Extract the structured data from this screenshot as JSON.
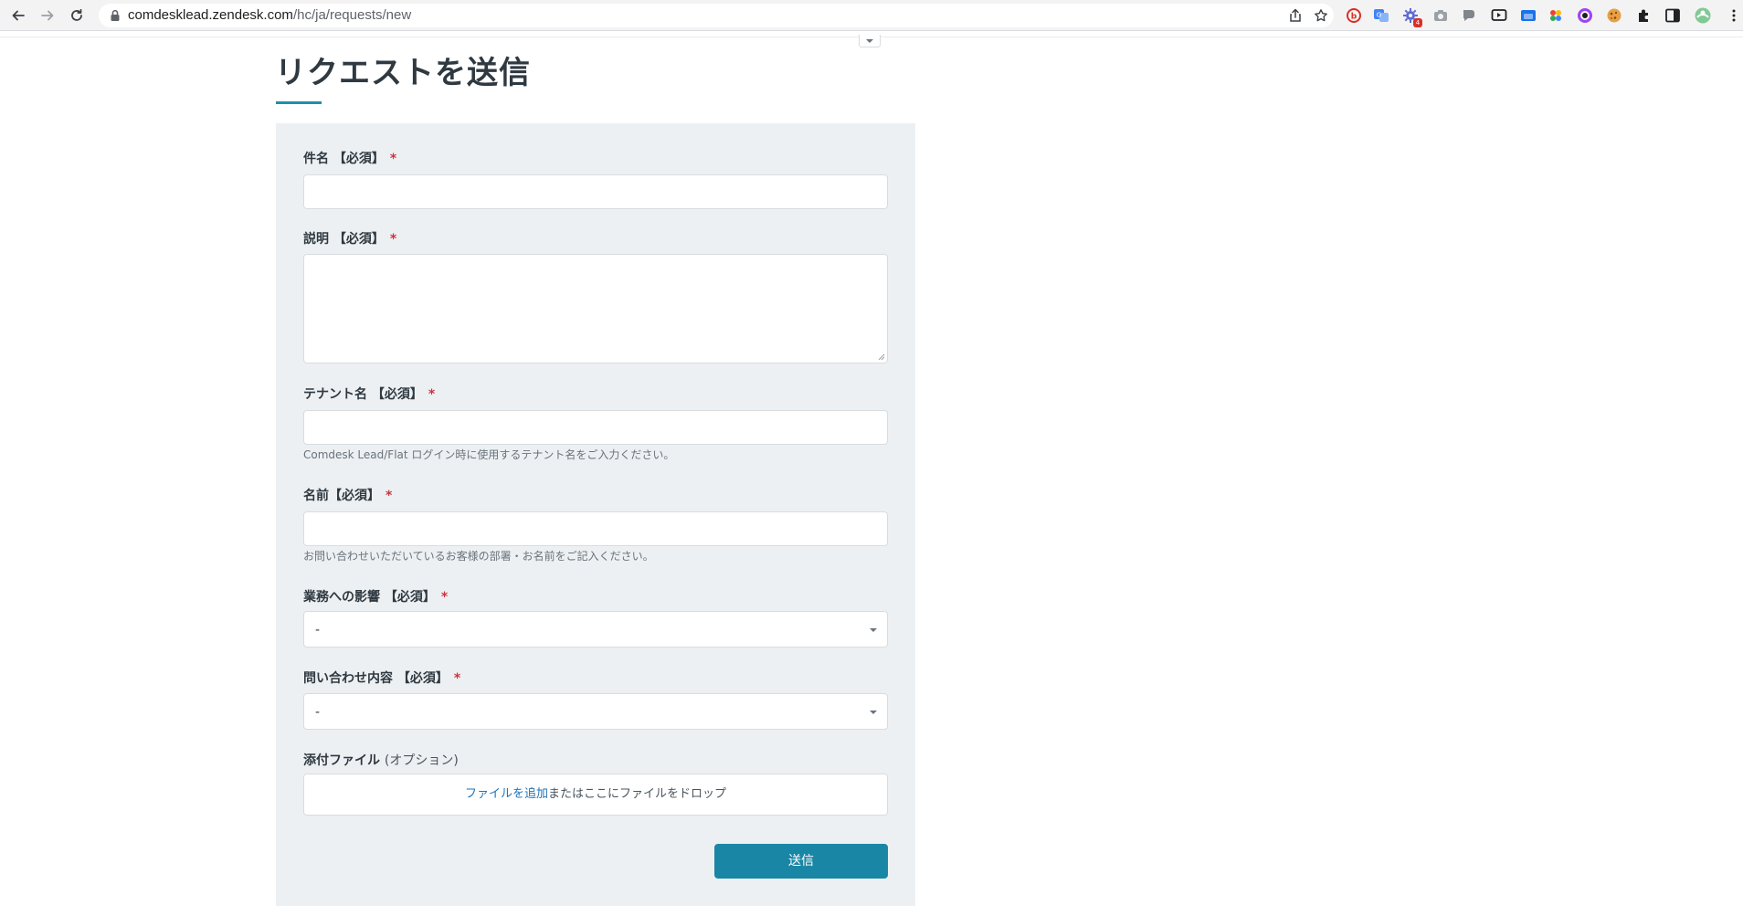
{
  "browser": {
    "url_host": "comdesklead.zendesk.com",
    "url_path": "/hc/ja/requests/new",
    "extensions": [
      "adblock-icon",
      "translate-icon",
      "extension-gear-icon",
      "camera-icon",
      "speech-bubble-icon",
      "media-icon",
      "screen-share-icon",
      "google-apps-icon",
      "circle-app-icon",
      "cookie-icon",
      "puzzle-icon",
      "side-panel-icon",
      "profile-avatar-icon"
    ],
    "extension_badge": "4",
    "colors": {
      "toolbar_bg": "#f3f3f4",
      "accent": "#1a86a5"
    }
  },
  "page": {
    "title": "リクエストを送信"
  },
  "form": {
    "subject": {
      "label": "件名 【必須】",
      "required_mark": "*",
      "value": ""
    },
    "description": {
      "label": "説明 【必須】",
      "required_mark": "*",
      "value": ""
    },
    "tenant": {
      "label": "テナント名 【必須】",
      "required_mark": "*",
      "value": "",
      "hint": "Comdesk Lead/Flat ログイン時に使用するテナント名をご入力ください。"
    },
    "name": {
      "label": "名前【必須】",
      "required_mark": "*",
      "value": "",
      "hint": "お問い合わせいただいているお客様の部署・お名前をご記入ください。"
    },
    "business_impact": {
      "label": "業務への影響 【必須】",
      "required_mark": "*",
      "selected": "-"
    },
    "inquiry_type": {
      "label": "問い合わせ内容 【必須】",
      "required_mark": "*",
      "selected": "-"
    },
    "attachments": {
      "label": "添付ファイル",
      "optional": "(オプション)",
      "add_link": "ファイルを追加",
      "drop_text": "またはここにファイルをドロップ"
    },
    "submit_label": "送信"
  }
}
